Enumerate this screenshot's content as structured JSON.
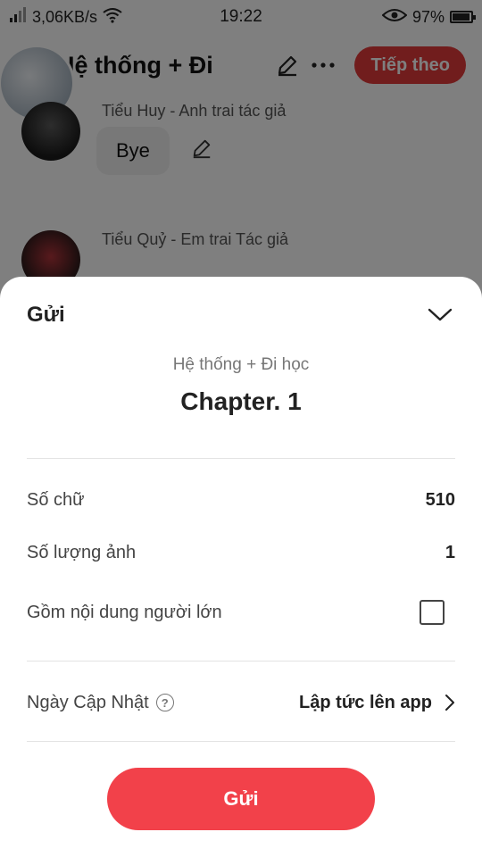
{
  "status_bar": {
    "network_speed": "3,06KB/s",
    "time": "19:22",
    "battery": "97%",
    "battery_level": 0.97
  },
  "top_bar": {
    "title": "Hệ thống + Đi",
    "next_label": "Tiếp theo"
  },
  "messages": [
    {
      "name": "Tiểu Huy - Anh trai tác giả",
      "text": "Bye"
    },
    {
      "name": "Tiểu Quỷ - Em trai Tác giả"
    }
  ],
  "sheet": {
    "title": "Gửi",
    "story_name": "Hệ thống + Đi học",
    "chapter_name": "Chapter. 1",
    "word_count_label": "Số chữ",
    "word_count": "510",
    "image_count_label": "Số lượng ảnh",
    "image_count": "1",
    "adult_content_label": "Gồm nội dung người lớn",
    "adult_content_checked": false,
    "update_date_label": "Ngày Cập Nhật",
    "update_date_value": "Lập tức lên app",
    "send_label": "Gửi"
  },
  "colors": {
    "accent": "#f2414a",
    "overlay": "rgba(0,0,0,0.5)"
  }
}
